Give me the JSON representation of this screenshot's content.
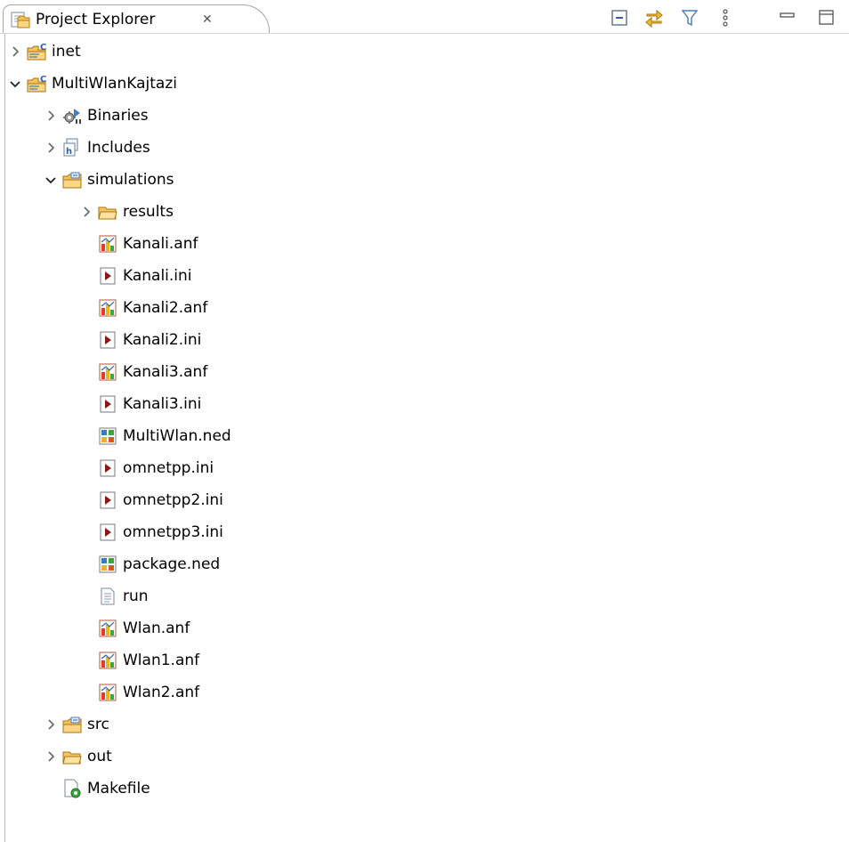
{
  "tab": {
    "title": "Project Explorer",
    "close_glyph": "✕",
    "icon": "project-explorer-icon"
  },
  "toolbar": [
    "collapse-all-icon",
    "link-with-editor-icon",
    "filter-icon",
    "view-menu-icon",
    "minimize-icon",
    "maximize-icon"
  ],
  "tree": [
    {
      "label": "inet",
      "depth": 0,
      "state": "collapsed",
      "icon": "c-project-icon"
    },
    {
      "label": "MultiWlanKajtazi",
      "depth": 0,
      "state": "expanded",
      "icon": "c-project-icon"
    },
    {
      "label": "Binaries",
      "depth": 1,
      "state": "collapsed",
      "icon": "binaries-icon"
    },
    {
      "label": "Includes",
      "depth": 1,
      "state": "collapsed",
      "icon": "includes-icon"
    },
    {
      "label": "simulations",
      "depth": 1,
      "state": "expanded",
      "icon": "source-folder-icon"
    },
    {
      "label": "results",
      "depth": 2,
      "state": "collapsed",
      "icon": "folder-icon"
    },
    {
      "label": "Kanali.anf",
      "depth": 2,
      "state": "leaf",
      "icon": "anf-file-icon"
    },
    {
      "label": "Kanali.ini",
      "depth": 2,
      "state": "leaf",
      "icon": "ini-file-icon"
    },
    {
      "label": "Kanali2.anf",
      "depth": 2,
      "state": "leaf",
      "icon": "anf-file-icon"
    },
    {
      "label": "Kanali2.ini",
      "depth": 2,
      "state": "leaf",
      "icon": "ini-file-icon"
    },
    {
      "label": "Kanali3.anf",
      "depth": 2,
      "state": "leaf",
      "icon": "anf-file-icon"
    },
    {
      "label": "Kanali3.ini",
      "depth": 2,
      "state": "leaf",
      "icon": "ini-file-icon"
    },
    {
      "label": "MultiWlan.ned",
      "depth": 2,
      "state": "leaf",
      "icon": "ned-file-icon"
    },
    {
      "label": "omnetpp.ini",
      "depth": 2,
      "state": "leaf",
      "icon": "ini-file-icon"
    },
    {
      "label": "omnetpp2.ini",
      "depth": 2,
      "state": "leaf",
      "icon": "ini-file-icon"
    },
    {
      "label": "omnetpp3.ini",
      "depth": 2,
      "state": "leaf",
      "icon": "ini-file-icon"
    },
    {
      "label": "package.ned",
      "depth": 2,
      "state": "leaf",
      "icon": "ned-file-icon"
    },
    {
      "label": "run",
      "depth": 2,
      "state": "leaf",
      "icon": "text-file-icon"
    },
    {
      "label": "Wlan.anf",
      "depth": 2,
      "state": "leaf",
      "icon": "anf-file-icon"
    },
    {
      "label": "Wlan1.anf",
      "depth": 2,
      "state": "leaf",
      "icon": "anf-file-icon"
    },
    {
      "label": "Wlan2.anf",
      "depth": 2,
      "state": "leaf",
      "icon": "anf-file-icon"
    },
    {
      "label": "src",
      "depth": 1,
      "state": "collapsed",
      "icon": "source-folder-icon"
    },
    {
      "label": "out",
      "depth": 1,
      "state": "collapsed",
      "icon": "folder-icon"
    },
    {
      "label": "Makefile",
      "depth": 1,
      "state": "leaf",
      "icon": "makefile-icon"
    }
  ]
}
